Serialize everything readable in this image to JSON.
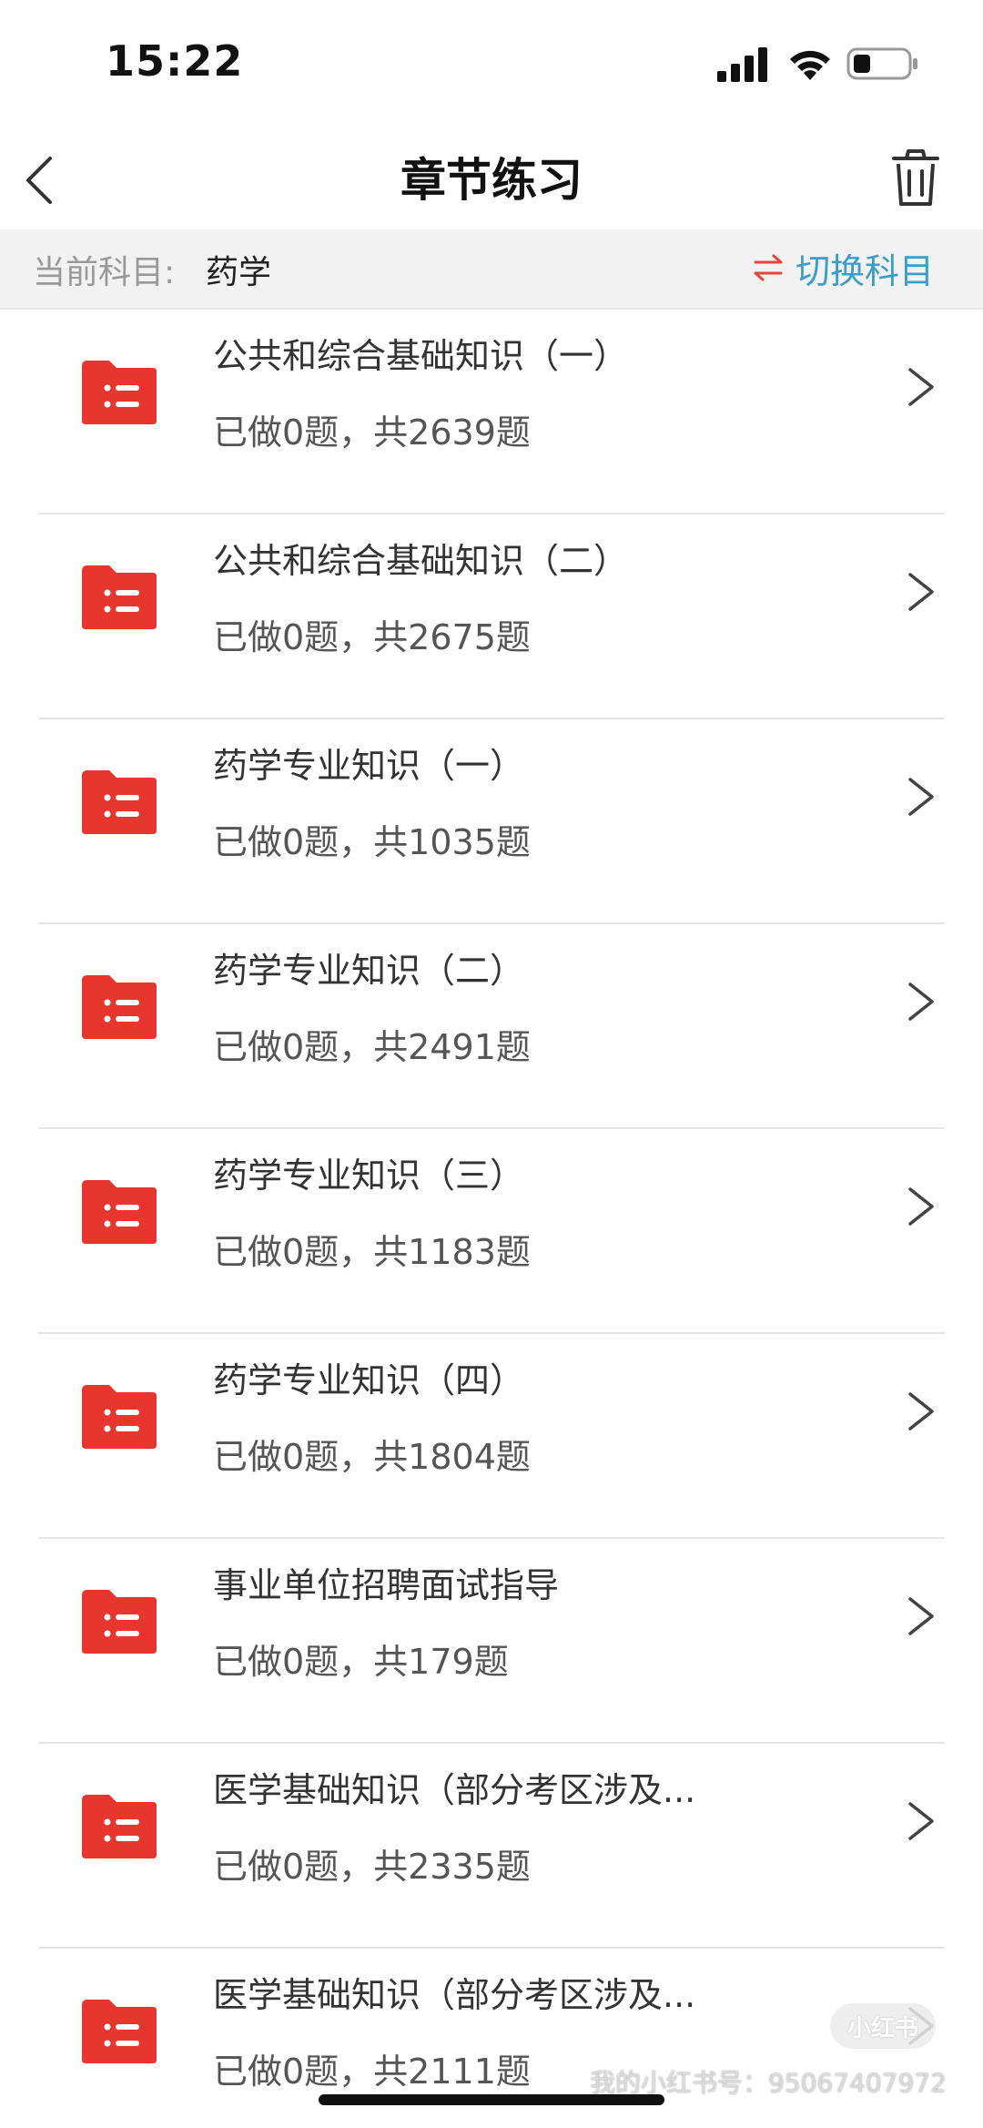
{
  "status_bar": {
    "time": "15:22",
    "icons": [
      "cellular-signal-icon",
      "wifi-icon",
      "battery-icon"
    ]
  },
  "nav": {
    "title": "章节练习",
    "back_icon": "chevron-left-icon",
    "action_icon": "trash-icon"
  },
  "subject": {
    "label": "当前科目:",
    "value": "药学",
    "switch_label": "切换科目",
    "switch_icon": "swap-arrows-icon"
  },
  "colors": {
    "folder_red": "#e8352d",
    "switch_blue": "#3a9ec9",
    "swap_icon_red": "#e2463c",
    "subject_bar_bg": "#f2f2f2"
  },
  "chapters": [
    {
      "title": "公共和综合基础知识（一）",
      "progress": "已做0题，共2639题",
      "icon": "folder-list-icon"
    },
    {
      "title": "公共和综合基础知识（二）",
      "progress": "已做0题，共2675题",
      "icon": "folder-list-icon"
    },
    {
      "title": "药学专业知识（一）",
      "progress": "已做0题，共1035题",
      "icon": "folder-list-icon"
    },
    {
      "title": "药学专业知识（二）",
      "progress": "已做0题，共2491题",
      "icon": "folder-list-icon"
    },
    {
      "title": "药学专业知识（三）",
      "progress": "已做0题，共1183题",
      "icon": "folder-list-icon"
    },
    {
      "title": "药学专业知识（四）",
      "progress": "已做0题，共1804题",
      "icon": "folder-list-icon"
    },
    {
      "title": "事业单位招聘面试指导",
      "progress": "已做0题，共179题",
      "icon": "folder-list-icon"
    },
    {
      "title": "医学基础知识（部分考区涉及...",
      "progress": "已做0题，共2335题",
      "icon": "folder-list-icon"
    },
    {
      "title": "医学基础知识（部分考区涉及...",
      "progress": "已做0题，共2111题",
      "icon": "folder-list-icon"
    }
  ],
  "watermark": {
    "badge": "小红书",
    "text": "我的小红书号：95067407972"
  }
}
